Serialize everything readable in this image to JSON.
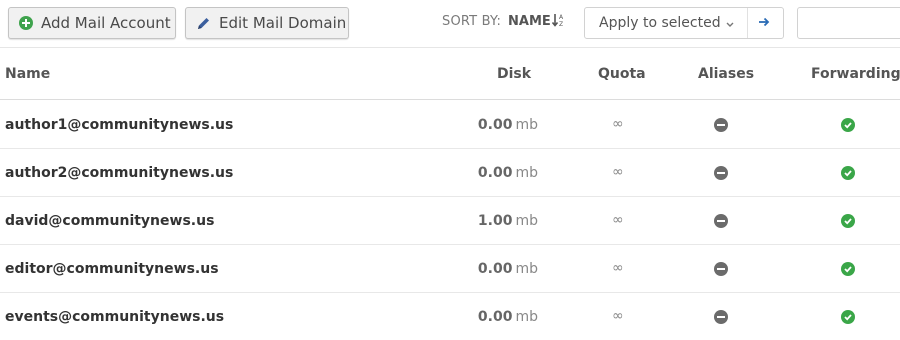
{
  "toolbar": {
    "add_mail_account_label": "Add Mail Account",
    "edit_mail_domain_label": "Edit Mail Domain",
    "sort_by_label": "SORT BY:",
    "sort_by_value": "NAME",
    "sort_icon": "sort-alpha-down-icon",
    "bulk_action_selected": "Apply to selected",
    "bulk_action_go_icon": "arrow-right-icon",
    "search_value": ""
  },
  "table": {
    "columns": [
      "Name",
      "Disk",
      "Quota",
      "Aliases",
      "Forwarding"
    ],
    "rows": [
      {
        "name": "author1@communitynews.us",
        "disk": "0.00",
        "unit": "mb",
        "quota": "∞",
        "aliases": "minus-circle-icon",
        "forwarding": "check-circle-icon"
      },
      {
        "name": "author2@communitynews.us",
        "disk": "0.00",
        "unit": "mb",
        "quota": "∞",
        "aliases": "minus-circle-icon",
        "forwarding": "check-circle-icon"
      },
      {
        "name": "david@communitynews.us",
        "disk": "1.00",
        "unit": "mb",
        "quota": "∞",
        "aliases": "minus-circle-icon",
        "forwarding": "check-circle-icon"
      },
      {
        "name": "editor@communitynews.us",
        "disk": "0.00",
        "unit": "mb",
        "quota": "∞",
        "aliases": "minus-circle-icon",
        "forwarding": "check-circle-icon"
      },
      {
        "name": "events@communitynews.us",
        "disk": "0.00",
        "unit": "mb",
        "quota": "∞",
        "aliases": "minus-circle-icon",
        "forwarding": "check-circle-icon"
      }
    ]
  },
  "colors": {
    "success_green": "#3aa648",
    "neutral_gray": "#6b6b6b",
    "link_blue": "#2a6bb5"
  }
}
